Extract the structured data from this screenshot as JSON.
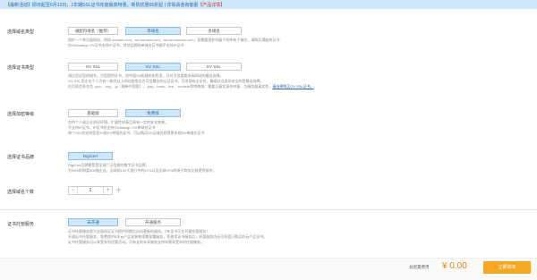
{
  "notice": {
    "text": "【最新活动】即日起至6月13日，1年期SSL证书年度最高特惠，新购优惠65折起 | 详情请咨询客服",
    "link": "【产品详情】"
  },
  "domain_type": {
    "label": "选择域名类型",
    "options": [
      "通配符域名（推荐）",
      "单域名",
      "多域名"
    ],
    "selected": "单域名",
    "desc": [
      "保护一个单页面网站，例如 domain.com、ssl.domain.com、ssl.ssl.domain.com，如需要保护同级子的所有子域名，请购买通配符证书",
      "仅Globalsign OV证书支持IP证书，其他品牌的单域名证书都不支持IP证书"
    ]
  },
  "cert_type": {
    "label": "选择证书类型",
    "options": [
      "OV SSL",
      "EV SSL",
      "EV SSL"
    ],
    "selected_index": 1,
    "desc": [
      "通过验证您的域名，为您提供证书，由中国CA权威机构签发，可对可信度要求高网站的最佳选择。",
      "OV SSL型企业个人为有一致性以上网站使用全名可信最佳的认证证书，可发现有企业名，确保站点身份安全的是最佳选择。",
      "在后续信息名包 .gov、.org、.jp（限新兴国家）、.pay、bank、live、.nuclear等特殊域：需要以真实身份申报，为服务器真实性，"
    ],
    "desc_link": "请选择购买OV SSL证书。"
  },
  "encryption": {
    "label": "选择加密等级",
    "options": [
      "基础版",
      "免费版"
    ],
    "selected_index": 1,
    "desc": [
      "仅供个人或企业测试环境，扩展性较高且具有一定的安全效果。",
      "不支持IP证书，IP证书仅支持Globalsign OV单域名证书",
      "每个OID仅支持签发20张DV单域名证书，可以购买DV泛域名获得更多的DV单域名证书"
    ]
  },
  "brand": {
    "label": "选择证书品牌",
    "options": [
      "DigiCert"
    ],
    "desc": [
      "DigiCert品牌更是受全球广泛信赖的数字证书品牌，",
      "为99%的财富500强企业，全球前100大银行中的97%以及全球97%的电子商务交易提供保护。"
    ]
  },
  "domain_count": {
    "label": "选择域名个数",
    "value": "1",
    "minus": "−",
    "plus": "+",
    "unit": "个"
  },
  "hosting": {
    "label": "证书托管服务",
    "options": [
      "未开通",
      "开通服务"
    ],
    "selected_index": 0,
    "desc": [
      "证书托管服务是为全面保证证书提供到期后自动更新的服务，2年证书可全开通托管服务！",
      "开通证书托管服务，免费提供5次云产品安装和续期部署服务，您使用证书服务后，托管服务内还可托管已购买的云产品证书。",
      "证书托管服务可以享受系列优惠活动，可有全的年享服务支持年限享受年的托管服务。"
    ]
  },
  "footer": {
    "fee_label": "总配置费用",
    "fee_amount": "¥ 0.00",
    "buy_label": "立即购买"
  },
  "colors": {
    "accent": "#2b6aa8",
    "active_bg": "#cfe7fb",
    "price": "#f08200",
    "buy": "#f5a623"
  }
}
